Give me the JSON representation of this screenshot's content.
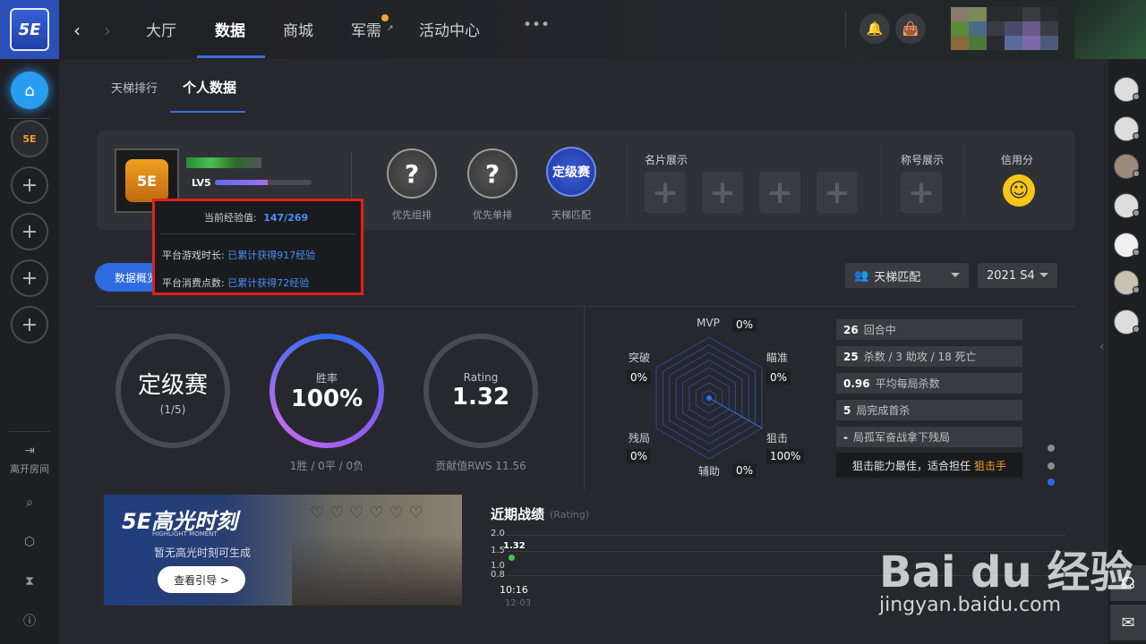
{
  "nav": {
    "logo": "5E",
    "tabs": [
      "大厅",
      "数据",
      "商城",
      "军需",
      "活动中心"
    ],
    "active_tab": 1,
    "more": "•••"
  },
  "subtabs": [
    "天梯排行",
    "个人数据"
  ],
  "profile": {
    "level": "LV5",
    "level_progress": 0.55,
    "avatar_text": "5E",
    "queue": [
      {
        "label": "优先组排",
        "icon": "?"
      },
      {
        "label": "优先单排",
        "icon": "?"
      }
    ],
    "ladder": {
      "badge": "定级赛",
      "label": "天梯匹配"
    },
    "card_show": "名片展示",
    "title_show": "称号展示",
    "credit": "信用分"
  },
  "tooltip": {
    "exp_label": "当前经验值:",
    "exp_value": "147/269",
    "play_label": "平台游戏时长:",
    "play_value": "已累计获得917经验",
    "spend_label": "平台消费点数:",
    "spend_value": "已累计获得72经验"
  },
  "controls": {
    "overview_btn": "数据概览",
    "mode_select": "天梯匹配",
    "season_select": "2021 S4"
  },
  "rings": {
    "rank": {
      "title": "定级赛",
      "sub": "(1/5)"
    },
    "winrate": {
      "label": "胜率",
      "value": "100%",
      "caption": "1胜 / 0平 / 0负"
    },
    "rating": {
      "label": "Rating",
      "value": "1.32",
      "caption": "贡献值RWS 11.56"
    }
  },
  "radar": {
    "mvp": {
      "label": "MVP",
      "value": "0%"
    },
    "aim": {
      "label": "瞄准",
      "value": "0%"
    },
    "snipe": {
      "label": "狙击",
      "value": "100%"
    },
    "assist": {
      "label": "辅助",
      "value": "0%"
    },
    "clutch": {
      "label": "残局",
      "value": "0%"
    },
    "breach": {
      "label": "突破",
      "value": "0%"
    }
  },
  "stats": [
    {
      "num": "26",
      "text": "回合中"
    },
    {
      "num": "25",
      "text": "杀数 / 3 助攻 / 18 死亡"
    },
    {
      "num": "0.96",
      "text": "平均每局杀数"
    },
    {
      "num": "5",
      "text": "局完成首杀"
    },
    {
      "num": "-",
      "text": "局孤军奋战拿下残局"
    }
  ],
  "stat_note": {
    "text": "狙击能力最佳，适合担任",
    "role": "狙击手"
  },
  "highlight": {
    "title": "5E高光时刻",
    "subtitle": "HIGHLIGHT MOMENT",
    "desc": "暂无高光时刻可生成",
    "button": "查看引导 >"
  },
  "recent": {
    "title": "近期战绩",
    "sub": "(Rating)",
    "yticks": [
      "2.0",
      "1.5",
      "1.0",
      "0.8"
    ],
    "point_value": "1.32",
    "point_time": "10:16",
    "point_date": "12-03"
  },
  "sidebar": {
    "leave_room": "离开房间"
  },
  "watermark": {
    "brand": "Bai du 经验",
    "url": "jingyan.baidu.com"
  },
  "colors": {
    "accent": "#2e6ae0",
    "tooltip_border": "#e0201a",
    "highlight_orange": "#f59a23"
  }
}
